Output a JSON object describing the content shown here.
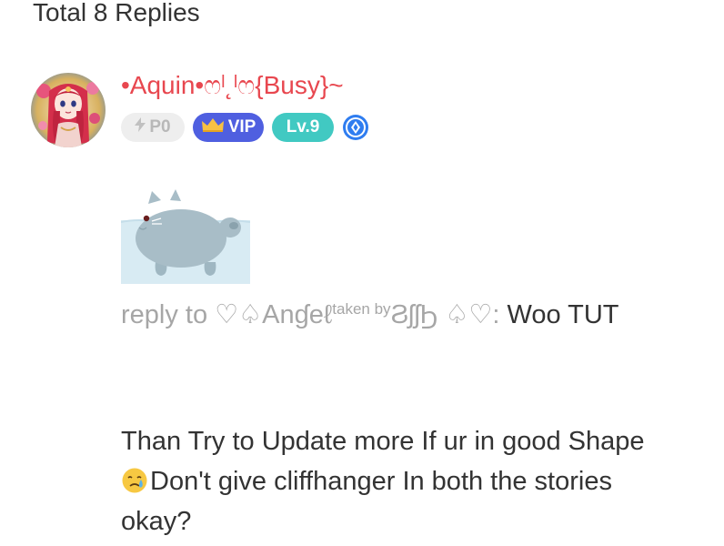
{
  "header": {
    "title": "Total 8 Replies"
  },
  "comment": {
    "username": "•Aquin•ෆˡ˛ˡෆ{Busy}~",
    "badges": {
      "power": "P0",
      "vip": "VIP",
      "level": "Lv.9"
    },
    "reply_prefix": "reply to ",
    "reply_target": "♡♤Anɠeℓ",
    "reply_target_sup": "taken by",
    "reply_target_suffix": "ϨʃʃϦ ♤♡",
    "reply_colon": ": ",
    "reply_text": "Woo TUT",
    "body_line1": "Than Try to Update more If ur in good Shape",
    "body_line2": "Don't give cliffhanger In both the stories",
    "body_line3": "okay?"
  },
  "icons": {
    "avatar": "avatar-image",
    "sticker": "cat-sticker-icon",
    "power_badge": "lightning-icon",
    "vip_badge": "crown-icon",
    "extra_badge": "diamond-icon",
    "emoji": "crying-face-emoji"
  },
  "colors": {
    "username": "#e8474f",
    "vip": "#4f5fe0",
    "level": "#41c9c2",
    "muted": "#a6a6a6",
    "text": "#333333"
  }
}
